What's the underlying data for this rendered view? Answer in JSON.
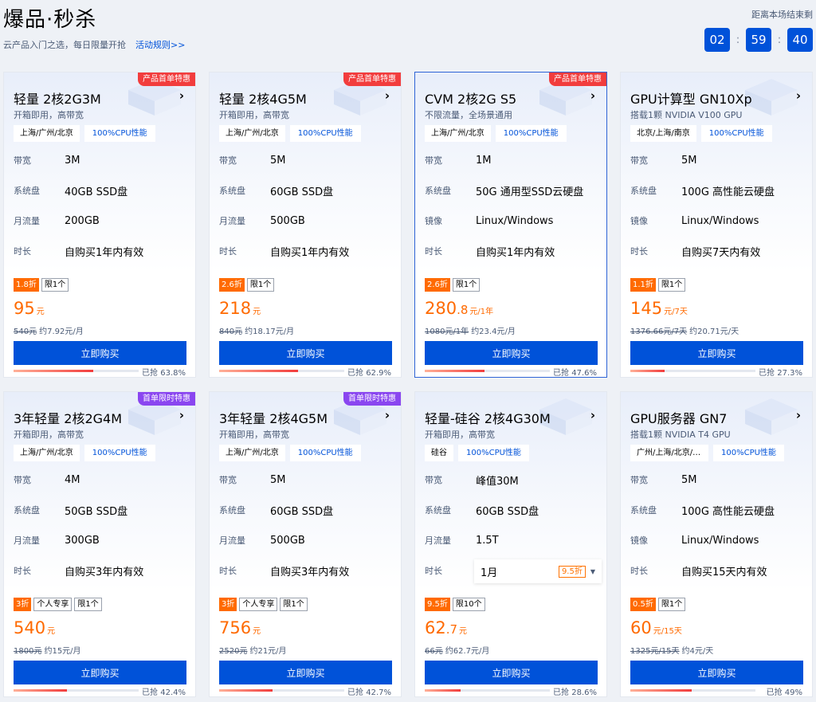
{
  "header": {
    "title": "爆品·秒杀",
    "subtitle": "云产品入门之选，每日限量开抢",
    "rules_link": "活动规则>>",
    "countdown_label": "距离本场结束剩",
    "countdown": {
      "hh": "02",
      "mm": "59",
      "ss": "40"
    }
  },
  "products": [
    {
      "title": "轻量 2核2G3M",
      "ribbon": "产品首单特惠",
      "ribbon_color": "#f23d3d",
      "desc": "开箱即用，高带宽",
      "region": "上海/广州/北京",
      "cpu_tag": "100%CPU性能",
      "specs": [
        {
          "k": "带宽",
          "v": "3M"
        },
        {
          "k": "系统盘",
          "v": "40GB SSD盘"
        },
        {
          "k": "月流量",
          "v": "200GB"
        },
        {
          "k": "时长",
          "v": "自购买1年内有效"
        }
      ],
      "discount": "1.8折",
      "badges": [
        "限1个"
      ],
      "price_int": "95",
      "price_dec": "",
      "price_unit": "元",
      "orig_price": "540元",
      "monthly": "约7.92元/月",
      "buy": "立即购买",
      "sold_label": "已抢 63.8%",
      "sold_pct": 63.8
    },
    {
      "title": "轻量 2核4G5M",
      "ribbon": "产品首单特惠",
      "ribbon_color": "#f23d3d",
      "desc": "开箱即用，高带宽",
      "region": "上海/广州/北京",
      "cpu_tag": "100%CPU性能",
      "specs": [
        {
          "k": "带宽",
          "v": "5M"
        },
        {
          "k": "系统盘",
          "v": "60GB SSD盘"
        },
        {
          "k": "月流量",
          "v": "500GB"
        },
        {
          "k": "时长",
          "v": "自购买1年内有效"
        }
      ],
      "discount": "2.6折",
      "badges": [
        "限1个"
      ],
      "price_int": "218",
      "price_dec": "",
      "price_unit": "元",
      "orig_price": "840元",
      "monthly": "约18.17元/月",
      "buy": "立即购买",
      "sold_label": "已抢 62.9%",
      "sold_pct": 62.9
    },
    {
      "title": "CVM 2核2G S5",
      "ribbon": "产品首单特惠",
      "ribbon_color": "#f23d3d",
      "desc": "不限流量，全场景通用",
      "region": "上海/广州/北京",
      "cpu_tag": "100%CPU性能",
      "specs": [
        {
          "k": "带宽",
          "v": "1M"
        },
        {
          "k": "系统盘",
          "v": "50G 通用型SSD云硬盘"
        },
        {
          "k": "镜像",
          "v": "Linux/Windows"
        },
        {
          "k": "时长",
          "v": "自购买1年内有效"
        }
      ],
      "discount": "2.6折",
      "badges": [
        "限1个"
      ],
      "price_int": "280",
      "price_dec": ".8",
      "price_unit": "元/1年",
      "orig_price": "1080元/1年",
      "monthly": "约23.4元/月",
      "buy": "立即购买",
      "sold_label": "已抢 47.6%",
      "sold_pct": 47.6
    },
    {
      "title": "GPU计算型 GN10Xp",
      "ribbon": "",
      "ribbon_color": "",
      "desc": "搭载1颗 NVIDIA V100 GPU",
      "region": "北京/上海/南京",
      "cpu_tag": "100%CPU性能",
      "specs": [
        {
          "k": "带宽",
          "v": "5M"
        },
        {
          "k": "系统盘",
          "v": "100G 高性能云硬盘"
        },
        {
          "k": "镜像",
          "v": "Linux/Windows"
        },
        {
          "k": "时长",
          "v": "自购买7天内有效"
        }
      ],
      "discount": "1.1折",
      "badges": [
        "限1个"
      ],
      "price_int": "145",
      "price_dec": "",
      "price_unit": "元/7天",
      "orig_price": "1376.66元/7天",
      "monthly": "约20.71元/天",
      "buy": "立即购买",
      "sold_label": "已抢 27.3%",
      "sold_pct": 27.3
    },
    {
      "title": "3年轻量 2核2G4M",
      "ribbon": "首单限时特惠",
      "ribbon_color": "#8a46f0",
      "desc": "开箱即用，高带宽",
      "region": "上海/广州/北京",
      "cpu_tag": "100%CPU性能",
      "specs": [
        {
          "k": "带宽",
          "v": "4M"
        },
        {
          "k": "系统盘",
          "v": "50GB SSD盘"
        },
        {
          "k": "月流量",
          "v": "300GB"
        },
        {
          "k": "时长",
          "v": "自购买3年内有效"
        }
      ],
      "discount": "3折",
      "badges": [
        "个人专享",
        "限1个"
      ],
      "price_int": "540",
      "price_dec": "",
      "price_unit": "元",
      "orig_price": "1800元",
      "monthly": "约15元/月",
      "buy": "立即购买",
      "sold_label": "已抢 42.4%",
      "sold_pct": 42.4
    },
    {
      "title": "3年轻量 2核4G5M",
      "ribbon": "首单限时特惠",
      "ribbon_color": "#8a46f0",
      "desc": "开箱即用，高带宽",
      "region": "上海/广州/北京",
      "cpu_tag": "100%CPU性能",
      "specs": [
        {
          "k": "带宽",
          "v": "5M"
        },
        {
          "k": "系统盘",
          "v": "60GB SSD盘"
        },
        {
          "k": "月流量",
          "v": "500GB"
        },
        {
          "k": "时长",
          "v": "自购买3年内有效"
        }
      ],
      "discount": "3折",
      "badges": [
        "个人专享",
        "限1个"
      ],
      "price_int": "756",
      "price_dec": "",
      "price_unit": "元",
      "orig_price": "2520元",
      "monthly": "约21元/月",
      "buy": "立即购买",
      "sold_label": "已抢 42.7%",
      "sold_pct": 42.7
    },
    {
      "title": "轻量-硅谷 2核4G30M",
      "ribbon": "",
      "ribbon_color": "",
      "desc": "开箱即用，高带宽",
      "region": "硅谷",
      "cpu_tag": "100%CPU性能",
      "specs": [
        {
          "k": "带宽",
          "v": "峰值30M"
        },
        {
          "k": "系统盘",
          "v": "60GB SSD盘"
        },
        {
          "k": "月流量",
          "v": "1.5T"
        },
        {
          "k": "时长",
          "v": ""
        }
      ],
      "duration_select": {
        "value": "1月",
        "badge": "9.5折"
      },
      "discount": "9.5折",
      "badges": [
        "限10个"
      ],
      "price_int": "62",
      "price_dec": ".7",
      "price_unit": "元",
      "orig_price": "66元",
      "monthly": "约62.7元/月",
      "buy": "立即购买",
      "sold_label": "已抢 28.6%",
      "sold_pct": 28.6
    },
    {
      "title": "GPU服务器 GN7",
      "ribbon": "",
      "ribbon_color": "",
      "desc": "搭载1颗 NVIDIA T4 GPU",
      "region": "广州/上海/北京/新加坡",
      "cpu_tag": "100%CPU性能",
      "specs": [
        {
          "k": "带宽",
          "v": "5M"
        },
        {
          "k": "系统盘",
          "v": "100G 高性能云硬盘"
        },
        {
          "k": "镜像",
          "v": "Linux/Windows"
        },
        {
          "k": "时长",
          "v": "自购买15天内有效"
        }
      ],
      "discount": "0.5折",
      "badges": [
        "限1个"
      ],
      "price_int": "60",
      "price_dec": "",
      "price_unit": "元/15天",
      "orig_price": "1325元/15天",
      "monthly": "约4元/天",
      "buy": "立即购买",
      "sold_label": "已抢 49%",
      "sold_pct": 49
    }
  ],
  "colors": {
    "primary": "#0052d9",
    "price": "#ff6a00",
    "ribbon_red": "#f23d3d",
    "ribbon_purple": "#8a46f0"
  }
}
